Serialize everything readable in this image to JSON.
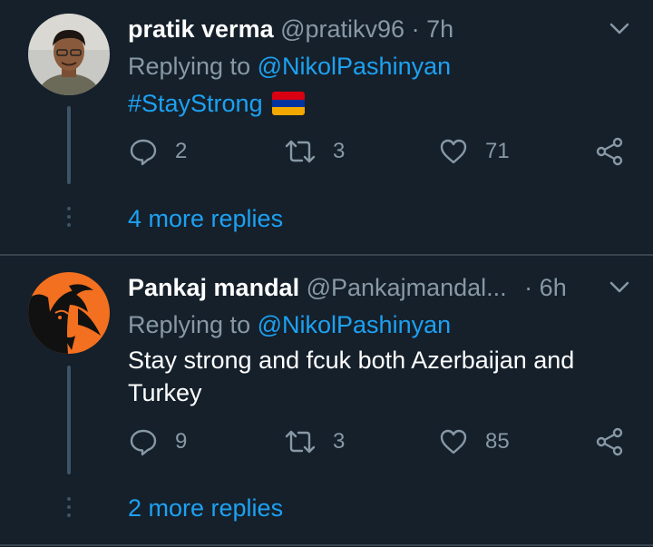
{
  "tweets": [
    {
      "name": "pratik verma",
      "handle": "@pratikv96",
      "separator": "·",
      "time": "7h",
      "replying_prefix": "Replying to",
      "replying_to": "@NikolPashinyan",
      "text": "#StayStrong",
      "emoji": "armenia-flag",
      "replies": "2",
      "retweets": "3",
      "likes": "71",
      "more_replies": "4 more replies"
    },
    {
      "name": "Pankaj mandal",
      "handle": "@Pankajmandal...",
      "separator": "·",
      "time": "6h",
      "replying_prefix": "Replying to",
      "replying_to": "@NikolPashinyan",
      "text": "Stay strong and fcuk both Azerbaijan and Turkey",
      "replies": "9",
      "retweets": "3",
      "likes": "85",
      "more_replies": "2 more replies"
    }
  ],
  "colors": {
    "background": "#15202b",
    "accent": "#1da1f2",
    "secondary_text": "#8899a6",
    "divider": "#38444d",
    "flag": [
      "#d90012",
      "#0033a0",
      "#f2a800"
    ]
  }
}
